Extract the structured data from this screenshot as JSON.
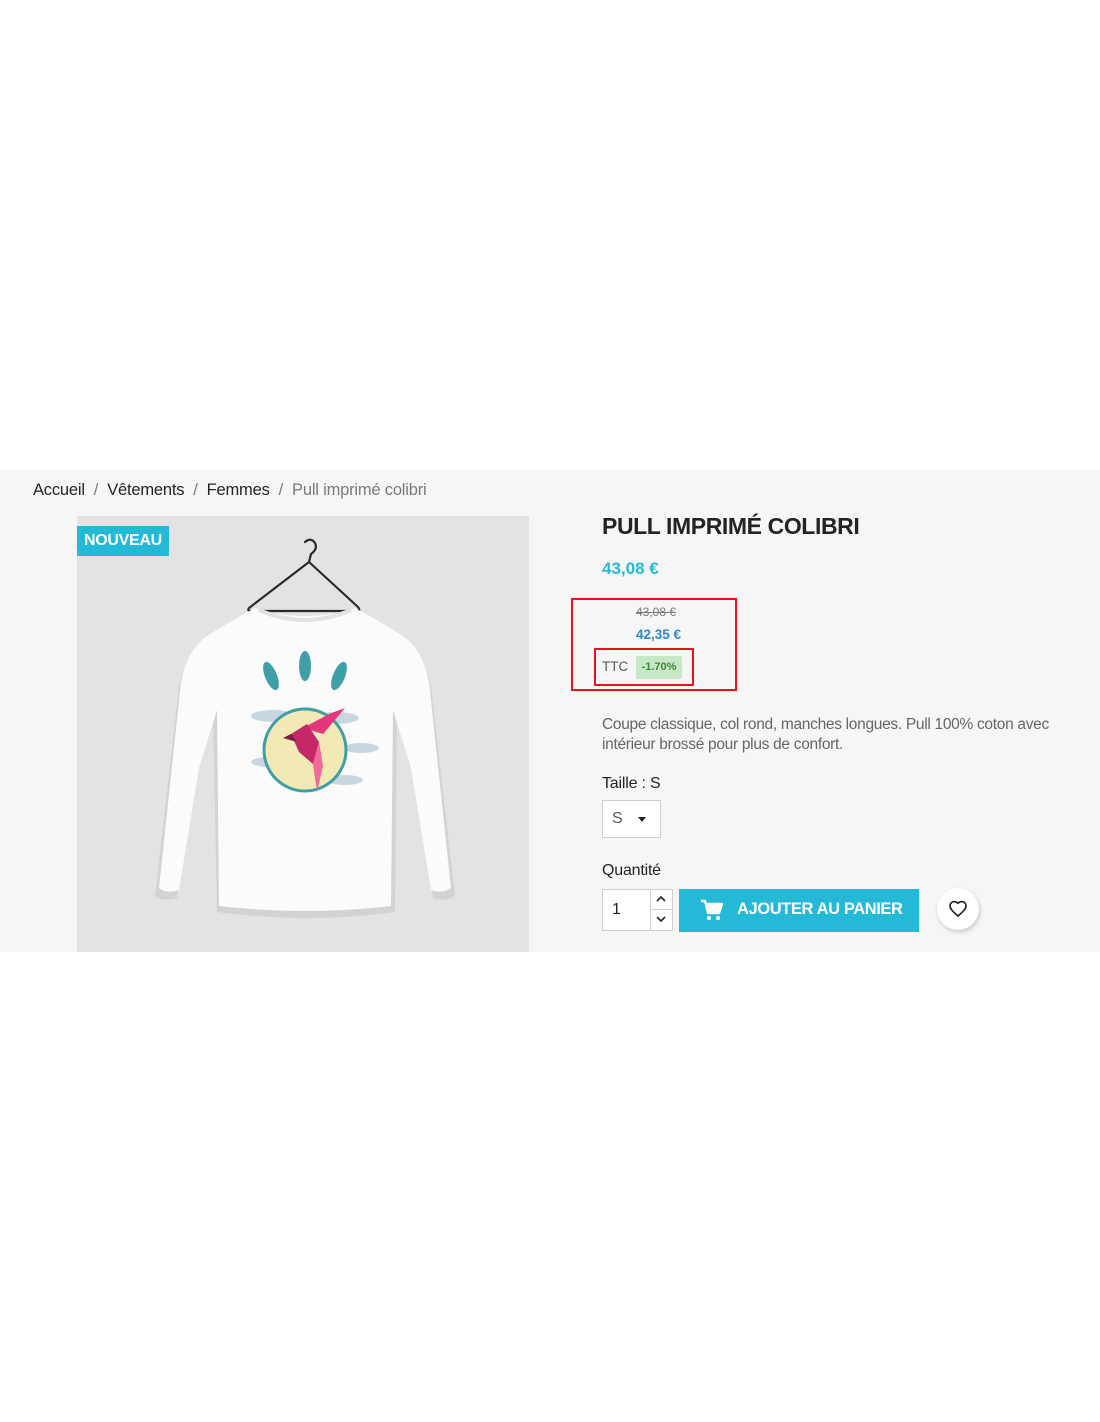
{
  "breadcrumb": {
    "items": [
      "Accueil",
      "Vêtements",
      "Femmes"
    ],
    "separator": "/",
    "current": "Pull imprimé colibri"
  },
  "product": {
    "badge": "NOUVEAU",
    "title": "PULL IMPRIMÉ COLIBRI",
    "price": "43,08 €",
    "old_price": "43,08 €",
    "new_price": "42,35 €",
    "tax_label": "TTC",
    "discount": "-1.70%",
    "description": "Coupe classique, col rond, manches longues. Pull 100% coton avec intérieur brossé pour plus de confort.",
    "image_icon": "long-sleeve-shirt-hummingbird-print"
  },
  "options": {
    "size_label": "Taille : S",
    "size_value": "S",
    "quantity_label": "Quantité",
    "quantity_value": "1"
  },
  "actions": {
    "add_to_cart": "AJOUTER AU PANIER",
    "cart_icon": "shopping-cart-icon",
    "wishlist_icon": "heart-outline-icon"
  },
  "colors": {
    "accent": "#24b9d7",
    "discount_bg": "#c6e8c6",
    "discount_text": "#3b8a3b",
    "highlight_box": "#e8141c",
    "section_bg": "#f6f6f6"
  }
}
